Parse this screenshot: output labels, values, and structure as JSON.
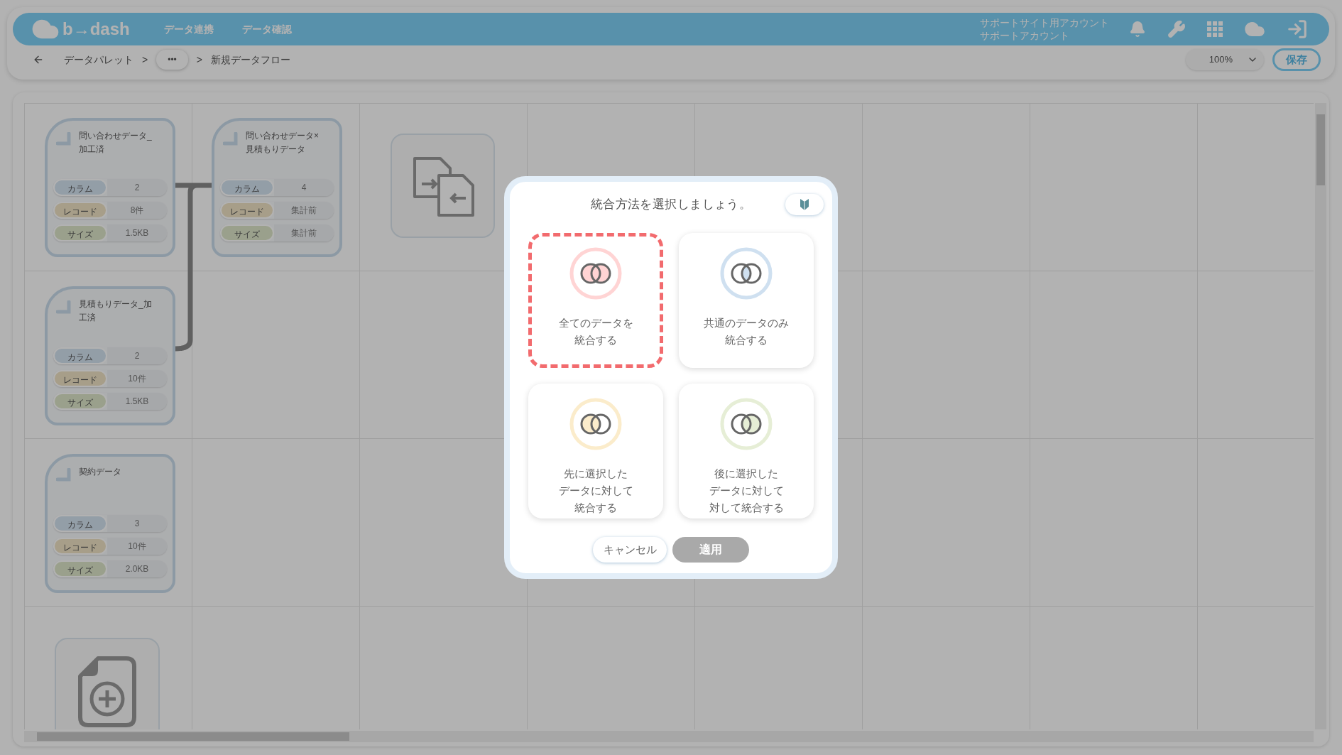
{
  "header": {
    "logo_text": "b→dash",
    "nav": [
      "データ連携",
      "データ確認"
    ],
    "account": [
      "サポートサイト用アカウント",
      "サポートアカウント"
    ]
  },
  "breadcrumb": {
    "items": [
      "データパレット",
      "•••",
      "新規データフロー"
    ],
    "separator": ">"
  },
  "toolbar": {
    "zoom": "100%",
    "save": "保存"
  },
  "cards": [
    {
      "title": "問い合わせデータ_加工済",
      "stats": [
        {
          "kind": "column",
          "label": "カラム",
          "value": "2"
        },
        {
          "kind": "record",
          "label": "レコード",
          "value": "8件"
        },
        {
          "kind": "size",
          "label": "サイズ",
          "value": "1.5KB"
        }
      ]
    },
    {
      "title": "問い合わせデータ×見積もりデータ",
      "stats": [
        {
          "kind": "column",
          "label": "カラム",
          "value": "4"
        },
        {
          "kind": "record",
          "label": "レコード",
          "value": "集計前"
        },
        {
          "kind": "size",
          "label": "サイズ",
          "value": "集計前"
        }
      ]
    },
    {
      "title": "見積もりデータ_加工済",
      "stats": [
        {
          "kind": "column",
          "label": "カラム",
          "value": "2"
        },
        {
          "kind": "record",
          "label": "レコード",
          "value": "10件"
        },
        {
          "kind": "size",
          "label": "サイズ",
          "value": "1.5KB"
        }
      ]
    },
    {
      "title": "契約データ",
      "stats": [
        {
          "kind": "column",
          "label": "カラム",
          "value": "3"
        },
        {
          "kind": "record",
          "label": "レコード",
          "value": "10件"
        },
        {
          "kind": "size",
          "label": "サイズ",
          "value": "2.0KB"
        }
      ]
    }
  ],
  "modal": {
    "title": "統合方法を選択しましょう。",
    "options": [
      {
        "kind": "all",
        "lines": [
          "全てのデータを",
          "統合する"
        ],
        "color": "#ffd4d4",
        "selected": true
      },
      {
        "kind": "inner",
        "lines": [
          "共通のデータのみ",
          "統合する"
        ],
        "color": "#cfe0f0",
        "selected": false
      },
      {
        "kind": "left",
        "lines": [
          "先に選択した",
          "データに対して",
          "統合する"
        ],
        "color": "#fbeccb",
        "selected": false
      },
      {
        "kind": "right",
        "lines": [
          "後に選択した",
          "データに対して",
          "対して統合する"
        ],
        "color": "#e6eed6",
        "selected": false
      }
    ],
    "cancel": "キャンセル",
    "apply": {
      "label": "適用",
      "disabled": true
    }
  }
}
